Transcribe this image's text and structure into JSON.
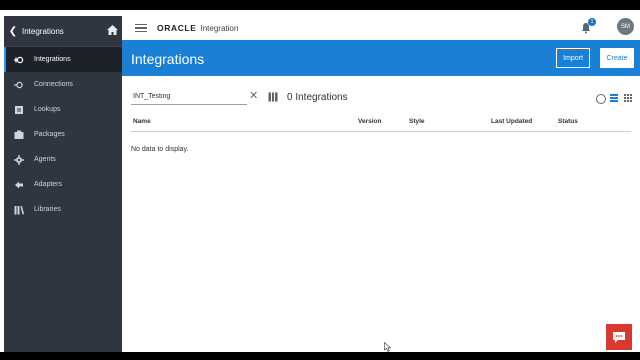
{
  "sidebar": {
    "title": "Integrations",
    "items": [
      {
        "label": "Integrations",
        "icon": "integrations-icon",
        "active": true
      },
      {
        "label": "Connections",
        "icon": "connections-icon"
      },
      {
        "label": "Lookups",
        "icon": "lookups-icon"
      },
      {
        "label": "Packages",
        "icon": "packages-icon"
      },
      {
        "label": "Agents",
        "icon": "agents-icon"
      },
      {
        "label": "Adapters",
        "icon": "adapters-icon"
      },
      {
        "label": "Libraries",
        "icon": "libraries-icon"
      }
    ]
  },
  "header": {
    "logo": "ORACLE",
    "app_name": "Integration",
    "notification_count": "1",
    "avatar_initials": "SM"
  },
  "page": {
    "title": "Integrations",
    "import_label": "Import",
    "create_label": "Create"
  },
  "toolbar": {
    "search_value": "INT_Testing",
    "count_text": "0 Integrations"
  },
  "table": {
    "columns": {
      "name": "Name",
      "version": "Version",
      "style": "Style",
      "last_updated": "Last Updated",
      "status": "Status"
    },
    "empty_message": "No data to display."
  },
  "colors": {
    "accent": "#1a80d5",
    "sidebar_bg": "#2f3640",
    "chat_button": "#d9382e"
  }
}
